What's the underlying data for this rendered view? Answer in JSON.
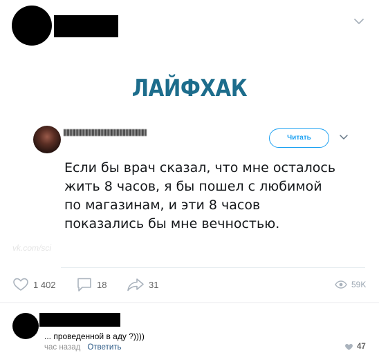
{
  "post": {
    "picture": {
      "title": "ЛАЙФХАК",
      "tweet": {
        "follow_label": "Читать",
        "text_lines": [
          "Если бы врач сказал, что мне осталось",
          "жить 8 часов, я бы пошел с любимой",
          "по магазинам, и эти 8 часов",
          "показались бы мне вечностью."
        ]
      },
      "watermark": "vk.com/sci"
    },
    "actions": {
      "likes": "1 402",
      "comments": "18",
      "shares": "31",
      "views": "59K"
    }
  },
  "comment": {
    "text": "... проведенной в аду ?))))",
    "time": "час назад",
    "reply_label": "Ответить",
    "likes": "47"
  },
  "colors": {
    "title": "#1d6d8c",
    "follow": "#1da1f2",
    "link": "#2a5885",
    "icon": "#aab3bd"
  }
}
